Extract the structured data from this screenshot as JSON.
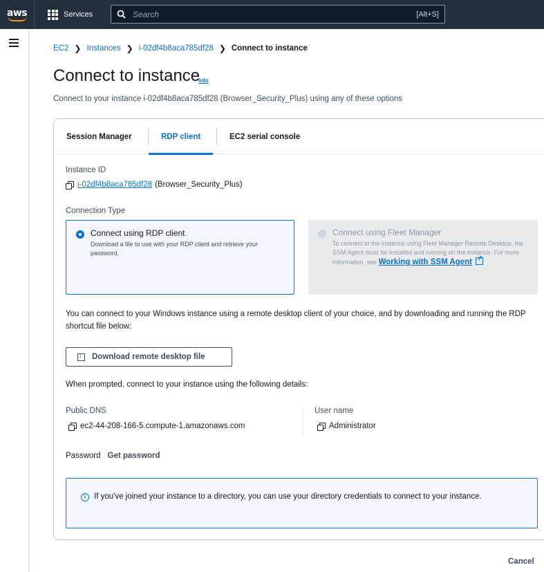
{
  "topnav": {
    "logo_text": "aws",
    "services_label": "Services",
    "search_placeholder": "Search",
    "search_shortcut": "[Alt+S]"
  },
  "breadcrumb": {
    "items": [
      "EC2",
      "Instances",
      "i-02df4b8aca785df28"
    ],
    "current": "Connect to instance"
  },
  "page": {
    "title": "Connect to instance",
    "info": "Info",
    "description": "Connect to your instance i-02df4b8aca785df28 (Browser_Security_Plus) using any of these options"
  },
  "tabs": [
    {
      "label": "Session Manager",
      "active": false
    },
    {
      "label": "RDP client",
      "active": true
    },
    {
      "label": "EC2 serial console",
      "active": false
    }
  ],
  "instance": {
    "id_label": "Instance ID",
    "id": "i-02df4b8aca785df28",
    "name": "(Browser_Security_Plus)"
  },
  "connection_type": {
    "label": "Connection Type",
    "options": [
      {
        "title": "Connect using RDP client",
        "description": "Download a file to use with your RDP client and retrieve your password.",
        "selected": true,
        "disabled": false
      },
      {
        "title": "Connect using Fleet Manager",
        "description": "To connect to the instance using Fleet Manager Remote Desktop, the SSM Agent must be installed and running on the instance. For more information, see",
        "link": "Working with SSM Agent",
        "selected": false,
        "disabled": true
      }
    ]
  },
  "rdp": {
    "intro": "You can connect to your Windows instance using a remote desktop client of your choice, and by downloading and running the RDP shortcut file below:",
    "download_button": "Download remote desktop file",
    "prompt": "When prompted, connect to your instance using the following details:",
    "public_dns_label": "Public DNS",
    "public_dns": "ec2-44-208-166-5.compute-1.amazonaws.com",
    "username_label": "User name",
    "username": "Administrator",
    "password_label": "Password",
    "get_password": "Get password"
  },
  "alert": {
    "text": "If you've joined your instance to a directory, you can use your directory credentials to connect to your instance."
  },
  "footer": {
    "cancel": "Cancel"
  },
  "colors": {
    "nav_bg": "#232f3e",
    "accent": "#0972d3",
    "aws_orange": "#ff9900"
  }
}
